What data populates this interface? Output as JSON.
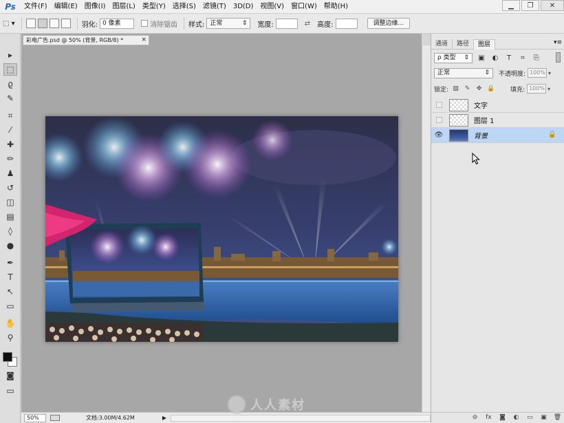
{
  "app": {
    "logo": "Ps"
  },
  "menu": [
    "文件(F)",
    "编辑(E)",
    "图像(I)",
    "图层(L)",
    "类型(Y)",
    "选择(S)",
    "滤镜(T)",
    "3D(D)",
    "视图(V)",
    "窗口(W)",
    "帮助(H)"
  ],
  "window_controls": {
    "minimize": "▁",
    "restore": "❐",
    "close": "✕"
  },
  "options": {
    "tool_preset": "⬚ ▾",
    "feather_label": "羽化:",
    "feather_value": "0 像素",
    "antialias_label": "消除锯齿",
    "style_label": "样式:",
    "style_value": "正常",
    "width_label": "宽度:",
    "swap_icon": "⇄",
    "height_label": "高度:",
    "refine_button": "调整边缘..."
  },
  "document": {
    "tab_title": "彩电广告.psd @ 50% (背景, RGB/8) *",
    "tab_close": "×"
  },
  "status": {
    "zoom": "50%",
    "doc_info": "文档:3.00M/4.62M",
    "arrow": "▶"
  },
  "watermark": {
    "text": "人人素材"
  },
  "panel": {
    "tabs": [
      "通道",
      "路径",
      "图层"
    ],
    "active_tab": "图层",
    "menu_icon": "▾≡",
    "filter_value": "ρ 类型",
    "filter_icons": [
      "▣",
      "◐",
      "T",
      "⌗",
      "⎘"
    ],
    "blend_mode": "正常",
    "opacity_label": "不透明度:",
    "opacity_value": "100%",
    "lock_label": "锁定:",
    "lock_icons": [
      "▨",
      "✎",
      "✥",
      "🔒"
    ],
    "fill_label": "填充:",
    "fill_value": "100%",
    "layers": [
      {
        "name": "文字",
        "visible": false,
        "selected": false,
        "locked": false
      },
      {
        "name": "图层 1",
        "visible": false,
        "selected": false,
        "locked": false
      },
      {
        "name": "背景",
        "visible": true,
        "selected": true,
        "locked": true
      }
    ],
    "footer_icons": [
      "⊖",
      "fx",
      "◙",
      "◐",
      "▭",
      "▣",
      "🗑"
    ]
  },
  "tools": [
    {
      "name": "move-tool",
      "glyph": "▸"
    },
    {
      "name": "marquee-tool",
      "glyph": "⬚",
      "active": true
    },
    {
      "name": "lasso-tool",
      "glyph": "ϱ"
    },
    {
      "name": "quick-select-tool",
      "glyph": "✎"
    },
    {
      "name": "crop-tool",
      "glyph": "⌗"
    },
    {
      "name": "eyedropper-tool",
      "glyph": "⁄"
    },
    {
      "name": "healing-tool",
      "glyph": "✚"
    },
    {
      "name": "brush-tool",
      "glyph": "✏"
    },
    {
      "name": "stamp-tool",
      "glyph": "♟"
    },
    {
      "name": "history-brush-tool",
      "glyph": "↺"
    },
    {
      "name": "eraser-tool",
      "glyph": "◫"
    },
    {
      "name": "gradient-tool",
      "glyph": "▤"
    },
    {
      "name": "blur-tool",
      "glyph": "◊"
    },
    {
      "name": "dodge-tool",
      "glyph": "●"
    },
    {
      "name": "pen-tool",
      "glyph": "✒"
    },
    {
      "name": "type-tool",
      "glyph": "T"
    },
    {
      "name": "path-select-tool",
      "glyph": "↖"
    },
    {
      "name": "shape-tool",
      "glyph": "▭"
    },
    {
      "name": "hand-tool",
      "glyph": "✋"
    },
    {
      "name": "zoom-tool",
      "glyph": "⚲"
    }
  ],
  "colors": {
    "foreground": "#111111",
    "background": "#ffffff",
    "selected_layer": "#bcd7f5"
  }
}
